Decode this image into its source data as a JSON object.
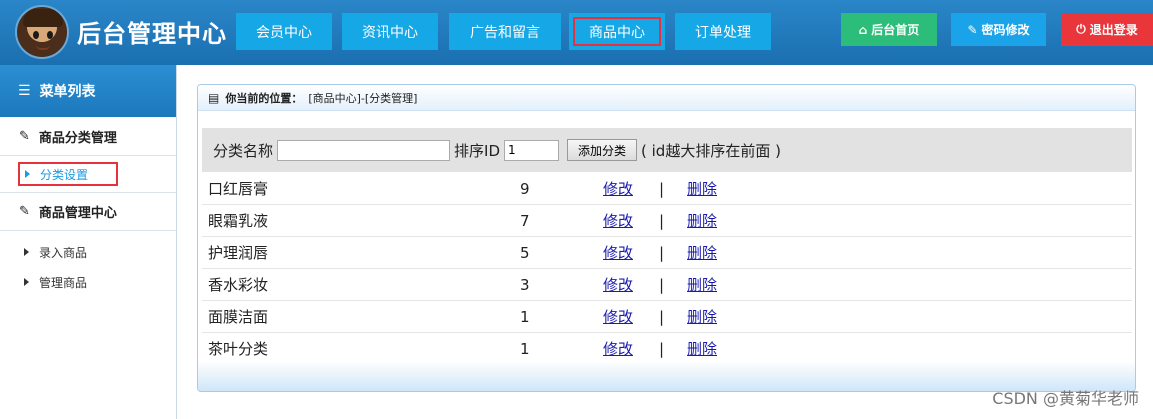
{
  "header": {
    "title": "后台管理中心",
    "nav": [
      "会员中心",
      "资讯中心",
      "广告和留言",
      "商品中心",
      "订单处理"
    ],
    "active_nav": "商品中心",
    "home_label": "后台首页",
    "password_label": "密码修改",
    "logout_label": "退出登录"
  },
  "sidebar": {
    "heading": "菜单列表",
    "sections": [
      {
        "title": "商品分类管理",
        "items": [
          "分类设置"
        ]
      },
      {
        "title": "商品管理中心",
        "items": [
          "录入商品",
          "管理商品"
        ]
      }
    ],
    "active_item": "分类设置"
  },
  "panel": {
    "location_label": "你当前的位置：",
    "location_path": "[商品中心]-[分类管理]",
    "form": {
      "name_label": "分类名称",
      "name_value": "",
      "sort_label": "排序ID",
      "sort_value": "1",
      "add_button": "添加分类",
      "hint": "( id越大排序在前面 )"
    },
    "edit_label": "修改",
    "separator": "|",
    "delete_label": "删除",
    "categories": [
      {
        "name": "口红唇膏",
        "sort": "9"
      },
      {
        "name": "眼霜乳液",
        "sort": "7"
      },
      {
        "name": "护理润唇",
        "sort": "5"
      },
      {
        "name": "香水彩妆",
        "sort": "3"
      },
      {
        "name": "面膜洁面",
        "sort": "1"
      },
      {
        "name": "茶叶分类",
        "sort": "1"
      }
    ]
  },
  "watermark": "CSDN @黄菊华老师",
  "colors": {
    "header": "#1a6fb0",
    "nav": "#16a7e6",
    "active_outline": "#e6323c",
    "home": "#2dbd7a",
    "password": "#1aa3e8",
    "logout": "#e8363a"
  }
}
